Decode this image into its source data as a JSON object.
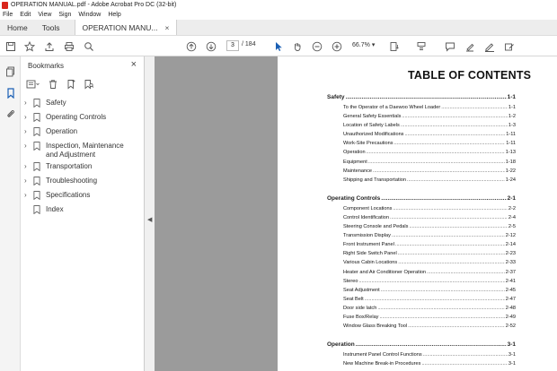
{
  "window": {
    "title": "OPERATION MANUAL.pdf - Adobe Acrobat Pro DC (32-bit)"
  },
  "menu": [
    "File",
    "Edit",
    "View",
    "Sign",
    "Window",
    "Help"
  ],
  "tabs": {
    "home": "Home",
    "tools": "Tools",
    "doc": "OPERATION MANU...",
    "close": "×"
  },
  "toolbar": {
    "page_current": "3",
    "page_sep": "/",
    "page_total": "184",
    "zoom": "66.7%"
  },
  "bookmarks": {
    "title": "Bookmarks",
    "close": "×",
    "items": [
      {
        "label": "Safety",
        "expandable": true
      },
      {
        "label": "Operating Controls",
        "expandable": true
      },
      {
        "label": "Operation",
        "expandable": true
      },
      {
        "label": "Inspection, Maintenance and Adjustment",
        "expandable": true
      },
      {
        "label": "Transportation",
        "expandable": true
      },
      {
        "label": "Troubleshooting",
        "expandable": true
      },
      {
        "label": "Specifications",
        "expandable": true
      },
      {
        "label": "Index",
        "expandable": false
      }
    ]
  },
  "document": {
    "title": "TABLE OF CONTENTS",
    "sections": [
      {
        "title": "Safety",
        "page": "1-1",
        "entries": [
          {
            "t": "To the Operator of a Daewoo Wheel Loader",
            "p": "1-1"
          },
          {
            "t": "General Safety Essentials",
            "p": "1-2"
          },
          {
            "t": "Location of Safety Labels",
            "p": "1-3"
          },
          {
            "t": "Unauthorized Modifications",
            "p": "1-11"
          },
          {
            "t": "Work-Site Precautions",
            "p": "1-11"
          },
          {
            "t": "Operation",
            "p": "1-13"
          },
          {
            "t": "Equipment",
            "p": "1-18"
          },
          {
            "t": "Maintenance",
            "p": "1-22"
          },
          {
            "t": "Shipping and Transportation",
            "p": "1-24"
          }
        ]
      },
      {
        "title": "Operating Controls",
        "page": "2-1",
        "entries": [
          {
            "t": "Component Locations",
            "p": "2-2"
          },
          {
            "t": "Control Identification",
            "p": "2-4"
          },
          {
            "t": "Steering Console and Pedals",
            "p": "2-5"
          },
          {
            "t": "Transmission Display",
            "p": "2-12"
          },
          {
            "t": "Front Instrument Panel",
            "p": "2-14"
          },
          {
            "t": "Right Side Switch Panel",
            "p": "2-23"
          },
          {
            "t": "Various Cabin Locations",
            "p": "2-33"
          },
          {
            "t": "Heater and Air Conditioner Operation",
            "p": "2-37"
          },
          {
            "t": "Stereo",
            "p": "2-41"
          },
          {
            "t": "Seat Adjustment",
            "p": "2-45"
          },
          {
            "t": "Seat Belt",
            "p": "2-47"
          },
          {
            "t": "Door side latch",
            "p": "2-48"
          },
          {
            "t": "Fuse Box/Relay",
            "p": "2-49"
          },
          {
            "t": "Window Glass Breaking Tool",
            "p": "2-52"
          }
        ]
      },
      {
        "title": "Operation",
        "page": "3-1",
        "entries": [
          {
            "t": "Instrument Panel Control Functions",
            "p": "3-1"
          },
          {
            "t": "New Machine Break-in Procedures",
            "p": "3-1"
          }
        ]
      }
    ]
  },
  "colors": {
    "accent_blue": "#1a5fb4",
    "pdf_red": "#d9261c",
    "doc_bg": "#9b9b9b"
  }
}
